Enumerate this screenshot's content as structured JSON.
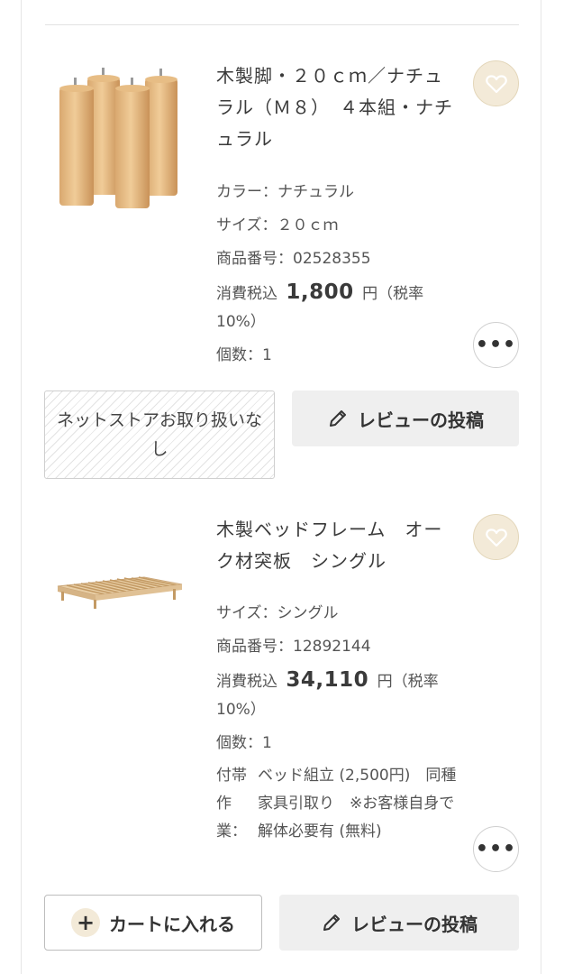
{
  "items": [
    {
      "title": "木製脚・２０ｃｍ／ナチュラル（Ｍ８）　４本組・ナチュラル",
      "color": "カラー：ナチュラル",
      "size": "サイズ：２０ｃｍ",
      "product_no": "商品番号：02528355",
      "price_label": "消費税込",
      "price_value": "1,800",
      "price_suffix": "円（税率10%）",
      "quantity": "個数：1",
      "unavailable_label": "ネットストアお取り扱いなし",
      "review_label": "レビューの投稿"
    },
    {
      "title": "木製ベッドフレーム　オーク材突板　シングル",
      "size": "サイズ：シングル",
      "product_no": "商品番号：12892144",
      "price_label": "消費税込",
      "price_value": "34,110",
      "price_suffix": "円（税率10%）",
      "quantity": "個数：1",
      "service_label": "付帯作業：",
      "service_text": "ベッド組立 (2,500円)　同種家具引取り　※お客様自身で解体必要有 (無料)",
      "cart_label": "カートに入れる",
      "review_label": "レビューの投稿"
    }
  ],
  "icons": {
    "favorite": "heart-icon",
    "more": "more-icon",
    "review": "pencil-icon",
    "add": "plus-icon"
  },
  "colors": {
    "accent_beige": "#f3ead8",
    "button_gray": "#efefef"
  }
}
